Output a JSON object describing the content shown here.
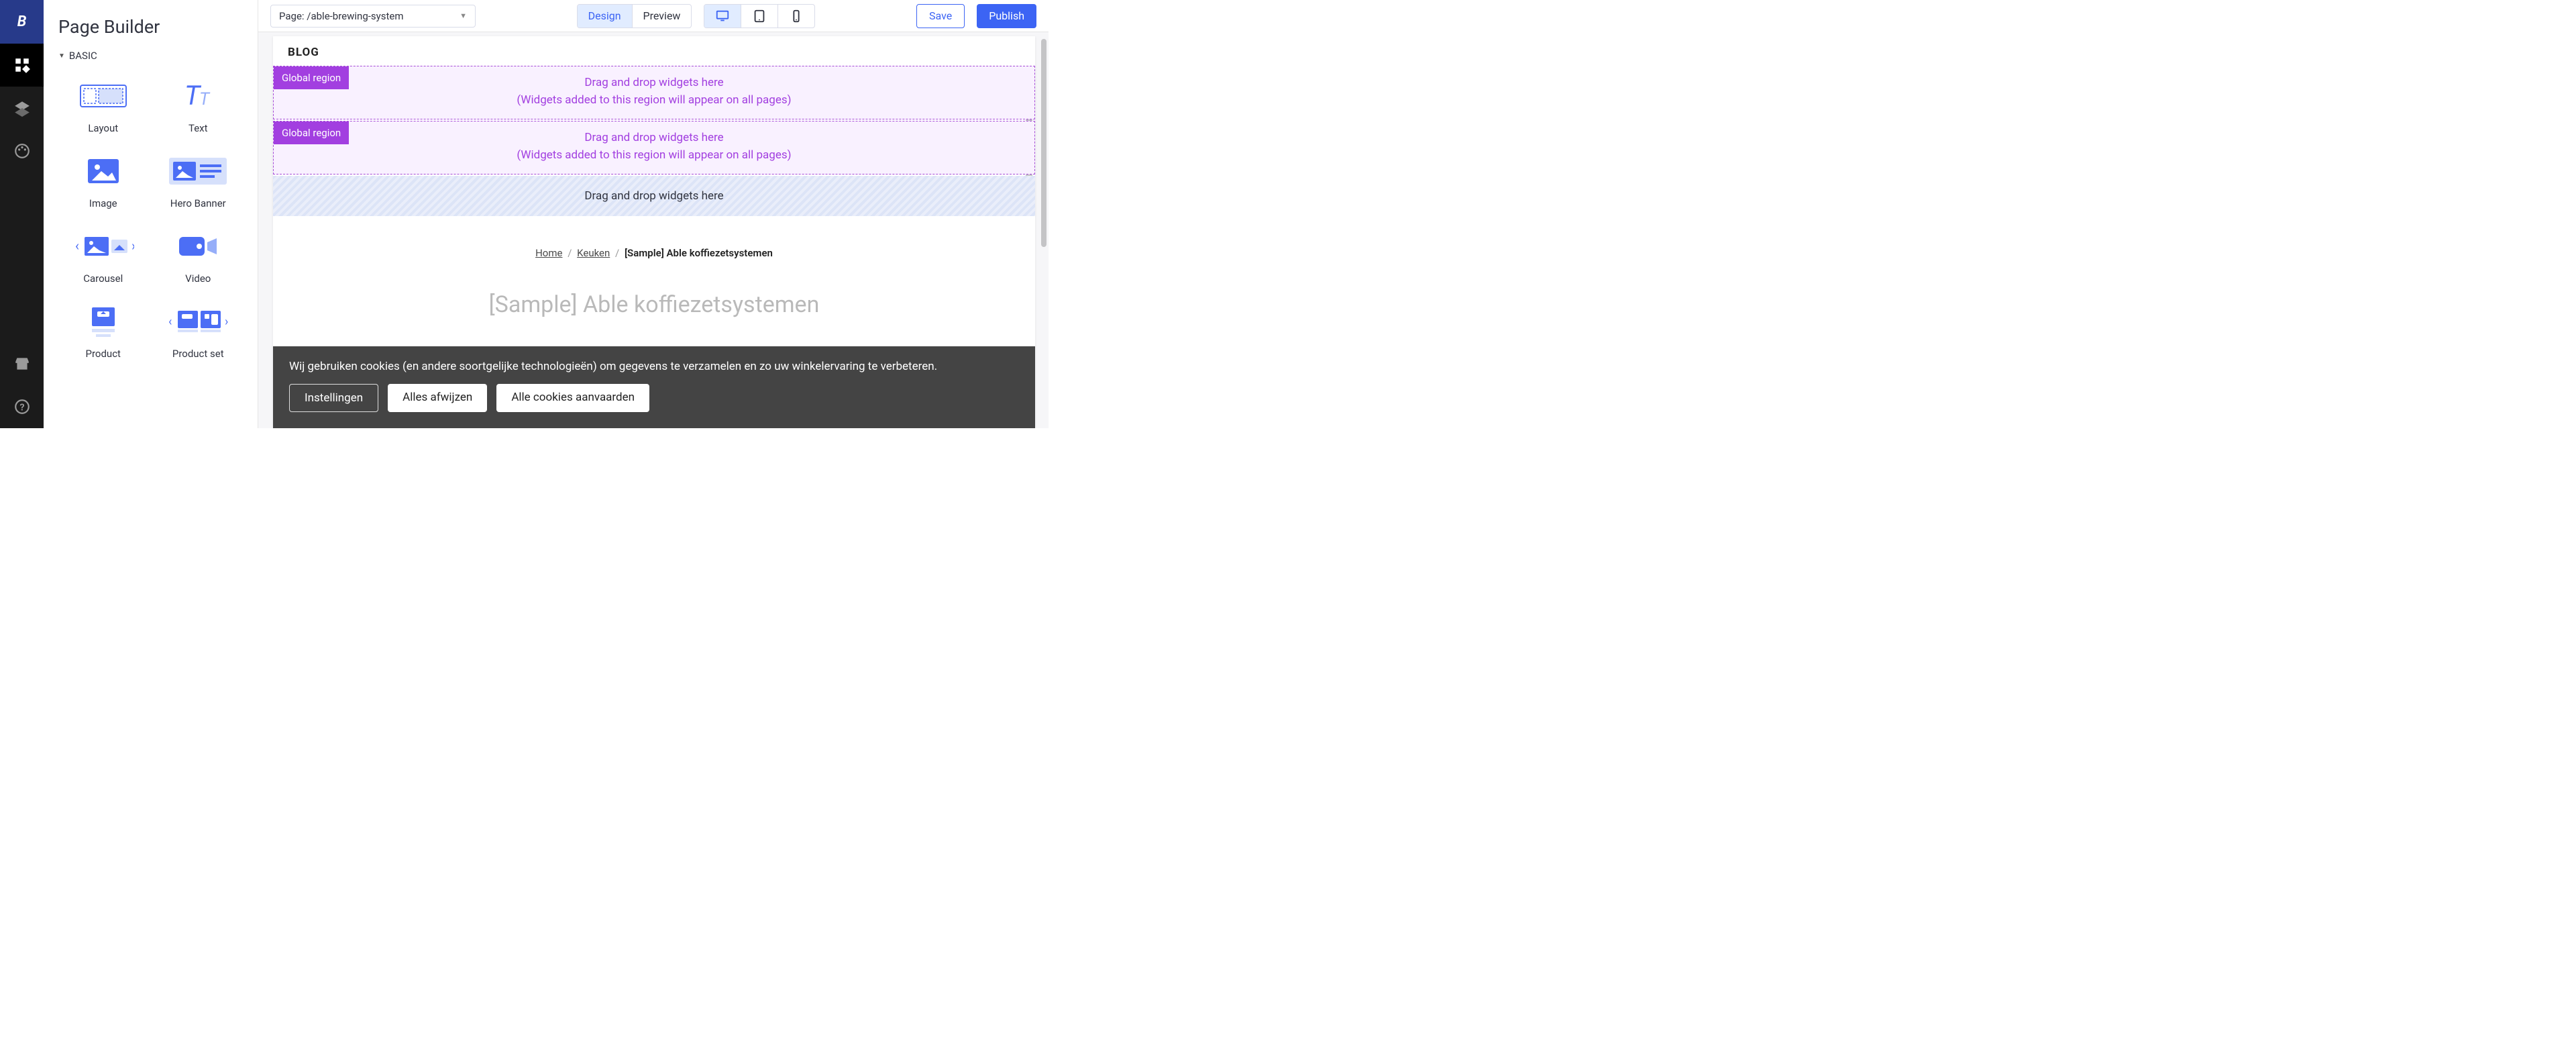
{
  "leftnav": {
    "logo": "B"
  },
  "sidebar": {
    "title": "Page Builder",
    "section": "BASIC",
    "widgets": [
      "Layout",
      "Text",
      "Image",
      "Hero Banner",
      "Carousel",
      "Video",
      "Product",
      "Product set"
    ]
  },
  "topbar": {
    "page_selector": "Page: /able-brewing-system",
    "design": "Design",
    "preview": "Preview",
    "save": "Save",
    "publish": "Publish"
  },
  "canvas": {
    "blog": "BLOG",
    "global_tag": "Global region",
    "drop_line1": "Drag and drop widgets here",
    "drop_line2": "(Widgets added to this region will appear on all pages)",
    "local_drop": "Drag and drop widgets here",
    "breadcrumbs": {
      "home": "Home",
      "cat": "Keuken",
      "current": "[Sample] Able koffiezetsystemen"
    },
    "page_title": "[Sample] Able koffiezetsystemen"
  },
  "cookie": {
    "msg": "Wij gebruiken cookies (en andere soortgelijke technologieën) om gegevens te verzamelen en zo uw winkelervaring te verbeteren.",
    "settings": "Instellingen",
    "reject": "Alles afwijzen",
    "accept": "Alle cookies aanvaarden"
  }
}
